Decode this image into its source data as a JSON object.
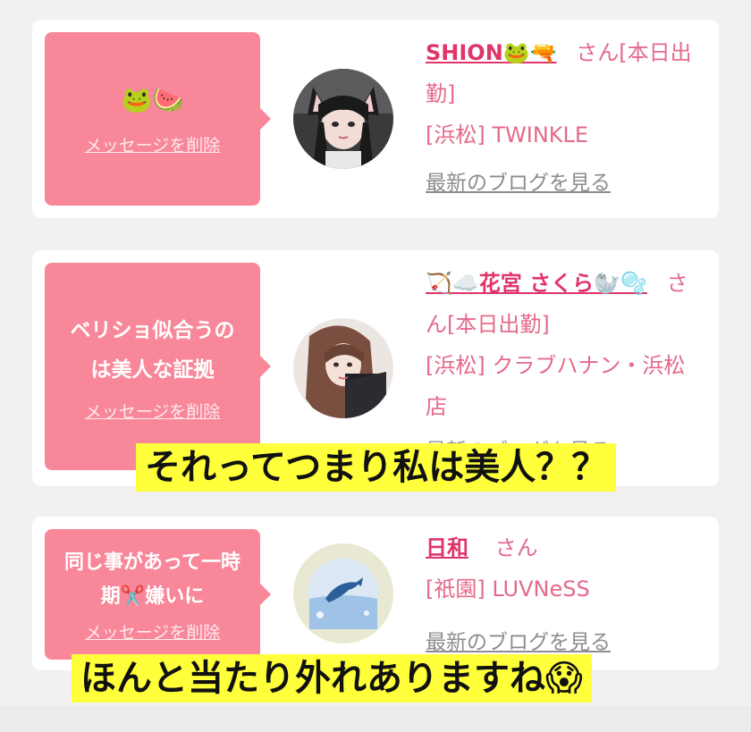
{
  "delete_label": "メッセージを削除",
  "blog_label": "最新のブログを見る",
  "cards": [
    {
      "message": "🐸🍉",
      "name": "SHION🐸🔫",
      "name_suffix": "さん[本日出勤]",
      "shop": "[浜松] TWINKLE",
      "avatar": "girl-with-cat-ears-avatar"
    },
    {
      "message": "ベリショ似合うのは美人な証拠",
      "name": "🏹☁️花宮 さくら🦭🫧",
      "name_suffix": "さん[本日出勤]",
      "shop": "[浜松] クラブハナン・浜松店",
      "avatar": "girl-portrait-avatar"
    },
    {
      "message": "同じ事があって一時期✂️嫌いに",
      "name": "日和",
      "name_suffix": "さん",
      "shop": "[祇園] LUVNeSS",
      "avatar": "dolphin-illustration-avatar"
    }
  ],
  "captions": [
    "それってつまり私は美人？？",
    "ほんと当たり外れありますね😱"
  ]
}
